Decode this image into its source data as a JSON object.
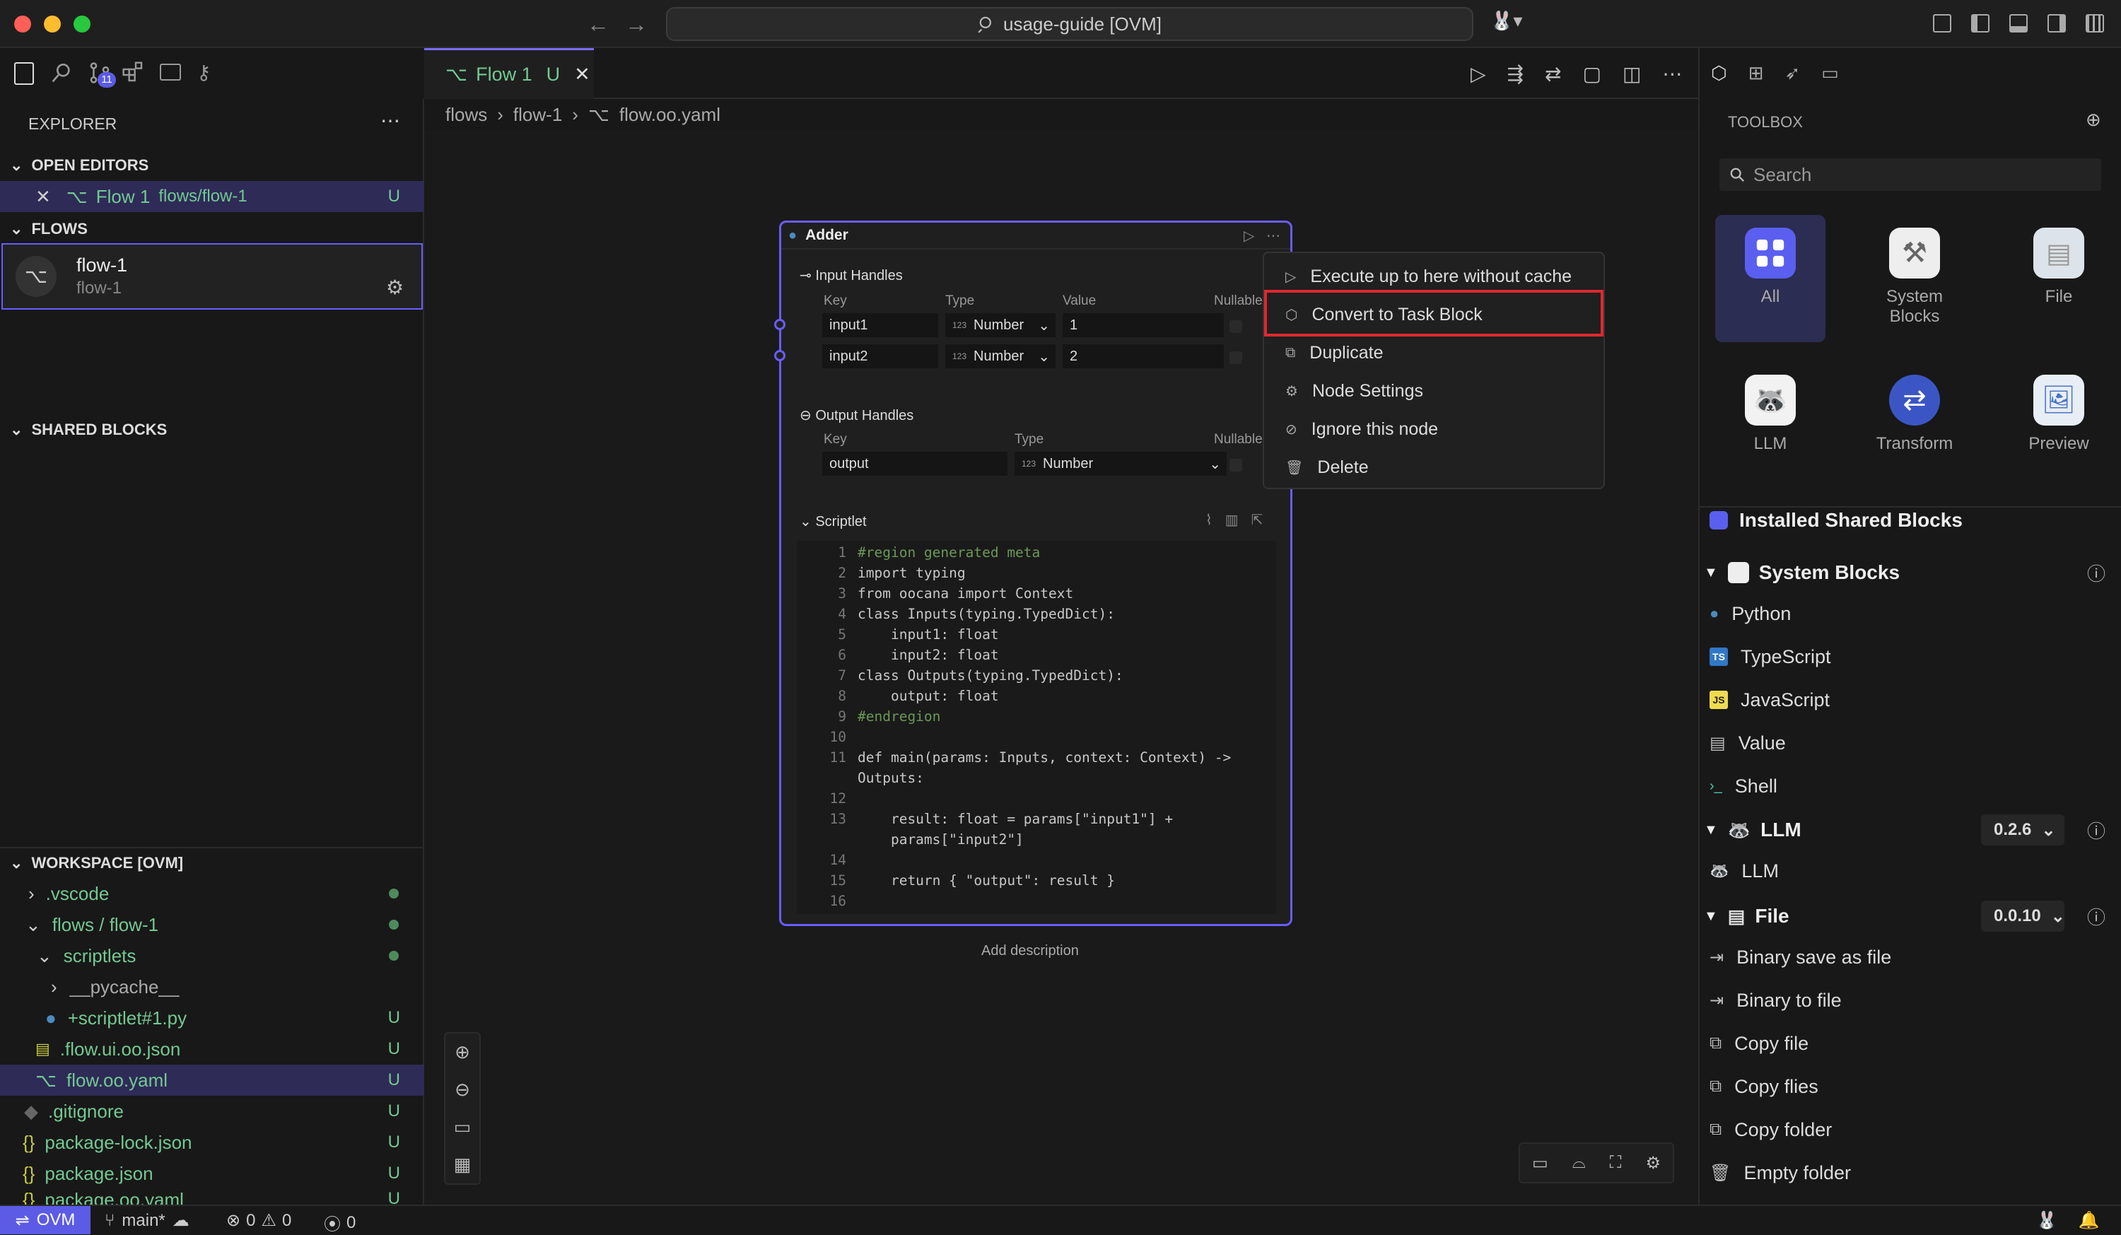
{
  "window": {
    "title": "usage-guide [OVM]"
  },
  "activity_bar": {
    "badge_count": "11"
  },
  "explorer": {
    "title": "EXPLORER",
    "open_editors_header": "OPEN EDITORS",
    "open_editor": {
      "name": "Flow 1",
      "path": "flows/flow-1",
      "status": "U"
    },
    "flows_header": "FLOWS",
    "flow_item": {
      "name": "flow-1",
      "subtitle": "flow-1"
    },
    "shared_blocks_header": "SHARED BLOCKS",
    "workspace_header": "WORKSPACE [OVM]",
    "files": [
      {
        "name": ".vscode",
        "status": ""
      },
      {
        "name": "flows / flow-1",
        "status": ""
      },
      {
        "name": "scriptlets",
        "status": ""
      },
      {
        "name": "__pycache__",
        "status": ""
      },
      {
        "name": "+scriptlet#1.py",
        "status": "U"
      },
      {
        "name": ".flow.ui.oo.json",
        "status": "U"
      },
      {
        "name": "flow.oo.yaml",
        "status": "U"
      },
      {
        "name": ".gitignore",
        "status": "U"
      },
      {
        "name": "package-lock.json",
        "status": "U"
      },
      {
        "name": "package.json",
        "status": "U"
      },
      {
        "name": "package.oo.yaml",
        "status": "U"
      }
    ]
  },
  "editor": {
    "tab": {
      "label": "Flow 1",
      "status": "U"
    },
    "breadcrumb": [
      "flows",
      "flow-1",
      "flow.oo.yaml"
    ]
  },
  "node": {
    "title": "Adder",
    "input_handles_label": "Input Handles",
    "col_key": "Key",
    "col_type": "Type",
    "col_value": "Value",
    "col_nullable": "Nullable",
    "inputs": [
      {
        "key": "input1",
        "type": "Number",
        "value": "1"
      },
      {
        "key": "input2",
        "type": "Number",
        "value": "2"
      }
    ],
    "output_handles_label": "Output Handles",
    "outputs": [
      {
        "key": "output",
        "type": "Number"
      }
    ],
    "scriptlet_label": "Scriptlet",
    "add_description": "Add description",
    "code_lines": [
      {
        "n": "1",
        "text": "#region generated meta"
      },
      {
        "n": "2",
        "text": "import typing"
      },
      {
        "n": "3",
        "text": "from oocana import Context"
      },
      {
        "n": "4",
        "text": "class Inputs(typing.TypedDict):"
      },
      {
        "n": "5",
        "text": "    input1: float"
      },
      {
        "n": "6",
        "text": "    input2: float"
      },
      {
        "n": "7",
        "text": "class Outputs(typing.TypedDict):"
      },
      {
        "n": "8",
        "text": "    output: float"
      },
      {
        "n": "9",
        "text": "#endregion"
      },
      {
        "n": "10",
        "text": ""
      },
      {
        "n": "11",
        "text": "def main(params: Inputs, context: Context) ->"
      },
      {
        "n": "",
        "text": "Outputs:"
      },
      {
        "n": "12",
        "text": ""
      },
      {
        "n": "13",
        "text": "    result: float = params[\"input1\"] +"
      },
      {
        "n": "",
        "text": "    params[\"input2\"]"
      },
      {
        "n": "14",
        "text": ""
      },
      {
        "n": "15",
        "text": "    return { \"output\": result }"
      },
      {
        "n": "16",
        "text": ""
      }
    ]
  },
  "context_menu": {
    "items": [
      {
        "label": "Execute up to here without cache",
        "icon": "play-icon"
      },
      {
        "label": "Convert to Task Block",
        "icon": "cube-icon",
        "highlighted": true
      },
      {
        "label": "Duplicate",
        "icon": "copy-icon"
      },
      {
        "label": "Node Settings",
        "icon": "gear-icon"
      },
      {
        "label": "Ignore this node",
        "icon": "ignore-icon"
      },
      {
        "label": "Delete",
        "icon": "trash-icon"
      }
    ],
    "highlight_color": "#e0282e"
  },
  "toolbox": {
    "title": "TOOLBOX",
    "search_placeholder": "Search",
    "categories": [
      {
        "label": "All",
        "icon": "grid-icon"
      },
      {
        "label": "System Blocks",
        "icon": "tools-icon"
      },
      {
        "label": "File",
        "icon": "file-icon"
      },
      {
        "label": "LLM",
        "icon": "raccoon-icon"
      },
      {
        "label": "Transform",
        "icon": "transform-icon"
      },
      {
        "label": "Preview",
        "icon": "preview-icon"
      }
    ],
    "installed_header": "Installed Shared Blocks",
    "system_blocks": {
      "name": "System Blocks",
      "items": [
        "Python",
        "TypeScript",
        "JavaScript",
        "Value",
        "Shell"
      ]
    },
    "llm_group": {
      "name": "LLM",
      "version": "0.2.6",
      "items": [
        "LLM"
      ]
    },
    "file_group": {
      "name": "File",
      "version": "0.0.10",
      "items": [
        "Binary save as file",
        "Binary to file",
        "Copy file",
        "Copy flies",
        "Copy folder",
        "Empty folder"
      ]
    }
  },
  "statusbar": {
    "remote": "OVM",
    "branch": "main*",
    "errors": "0",
    "warnings": "0",
    "ports": "0"
  },
  "colors": {
    "accent": "#6a5cff",
    "git_untracked": "#73c991"
  }
}
